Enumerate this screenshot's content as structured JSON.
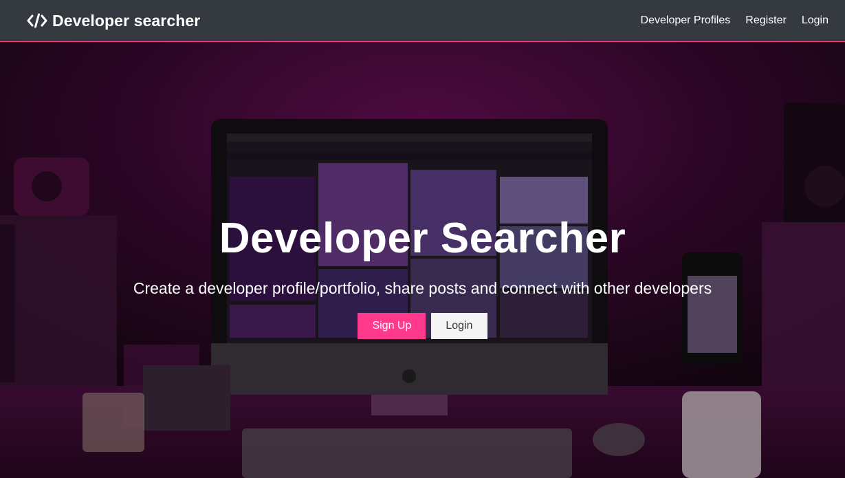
{
  "navbar": {
    "brand": "Developer searcher",
    "brand_icon": "code-icon",
    "links": [
      "Developer Profiles",
      "Register",
      "Login"
    ]
  },
  "hero": {
    "title": "Developer Searcher",
    "lead": "Create a developer profile/portfolio, share posts and connect with other developers",
    "signup_label": "Sign Up",
    "login_label": "Login"
  },
  "colors": {
    "navbar_bg": "#343a40",
    "accent": "#ff3a8c",
    "light_button": "#f4f4f4"
  }
}
